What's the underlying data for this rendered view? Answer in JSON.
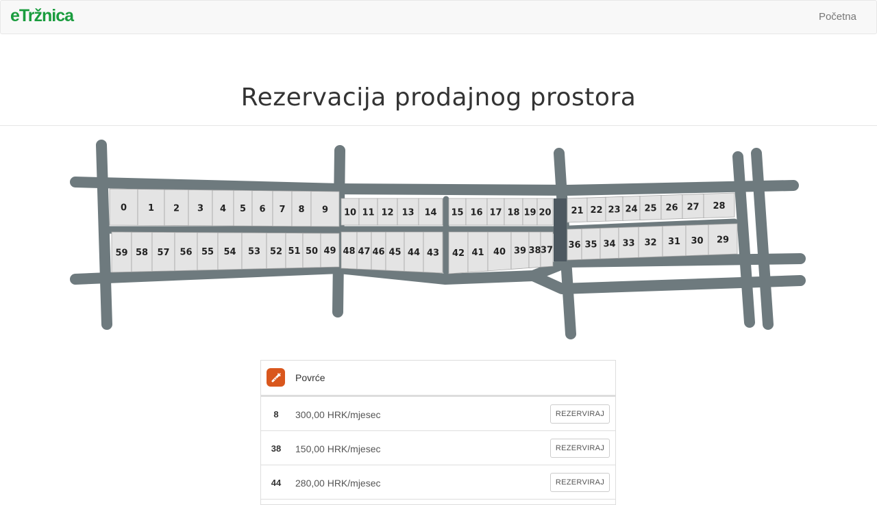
{
  "navbar": {
    "brand": "eTržnica",
    "links": [
      {
        "label": "Početna"
      }
    ]
  },
  "page": {
    "title": "Rezervacija prodajnog prostora"
  },
  "map": {
    "road_color": "#6e7a7e",
    "stall_color": "#e4e4e4",
    "selected_stall": "37",
    "top_row": [
      "0",
      "1",
      "2",
      "3",
      "4",
      "5",
      "6",
      "7",
      "8",
      "9",
      "10",
      "11",
      "12",
      "13",
      "14",
      "15",
      "16",
      "17",
      "18",
      "19",
      "20",
      "21",
      "22",
      "23",
      "24",
      "25",
      "26",
      "27",
      "28"
    ],
    "bottom_row": [
      "59",
      "58",
      "57",
      "56",
      "55",
      "54",
      "53",
      "52",
      "51",
      "50",
      "49",
      "48",
      "47",
      "46",
      "45",
      "44",
      "43",
      "42",
      "41",
      "40",
      "39",
      "38",
      "37",
      "36",
      "35",
      "34",
      "33",
      "32",
      "31",
      "30",
      "29"
    ]
  },
  "category": {
    "icon": "carrot-icon",
    "color": "#d9571d",
    "label": "Povrće"
  },
  "listings": [
    {
      "number": "8",
      "price": "300,00 HRK/mjesec",
      "action": "REZERVIRAJ"
    },
    {
      "number": "38",
      "price": "150,00 HRK/mjesec",
      "action": "REZERVIRAJ"
    },
    {
      "number": "44",
      "price": "280,00 HRK/mjesec",
      "action": "REZERVIRAJ"
    }
  ]
}
